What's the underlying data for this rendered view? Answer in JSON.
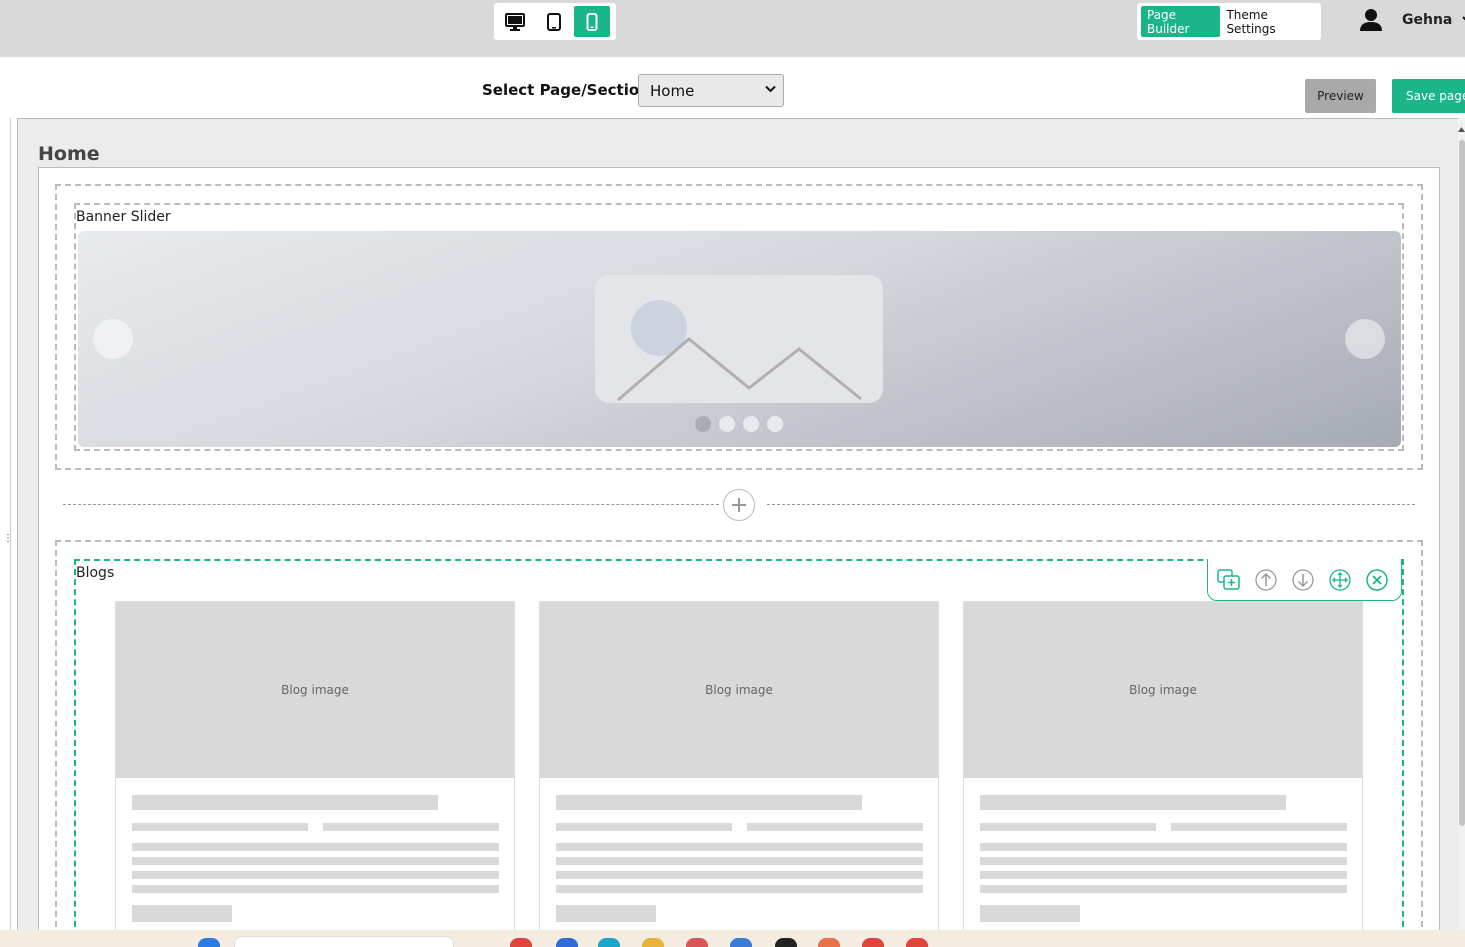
{
  "topbar": {
    "devices": [
      {
        "name": "desktop-icon",
        "active": false
      },
      {
        "name": "tablet-icon",
        "active": false
      },
      {
        "name": "mobile-icon",
        "active": true
      }
    ],
    "modes": {
      "page_builder": "Page Builder",
      "theme_settings": "Theme Settings"
    },
    "user": {
      "name": "Gehna",
      "icon": "user-icon"
    }
  },
  "selectbar": {
    "label": "Select Page/Section:",
    "selected": "Home"
  },
  "actions": {
    "preview": "Preview",
    "save": "Save page"
  },
  "page": {
    "title": "Home",
    "sections": [
      {
        "label": "Banner Slider",
        "pager_count": 4,
        "active_slide": 1
      },
      {
        "label": "Blogs",
        "cards": [
          {
            "image_label": "Blog image"
          },
          {
            "image_label": "Blog image"
          },
          {
            "image_label": "Blog image"
          }
        ]
      }
    ]
  },
  "section_toolbar": [
    "duplicate-icon",
    "move-up-icon",
    "move-down-icon",
    "move-icon",
    "close-icon"
  ],
  "colors": {
    "accent": "#1ab68a",
    "topbar": "#d9d9d9",
    "preview": "#a9a9a9"
  }
}
